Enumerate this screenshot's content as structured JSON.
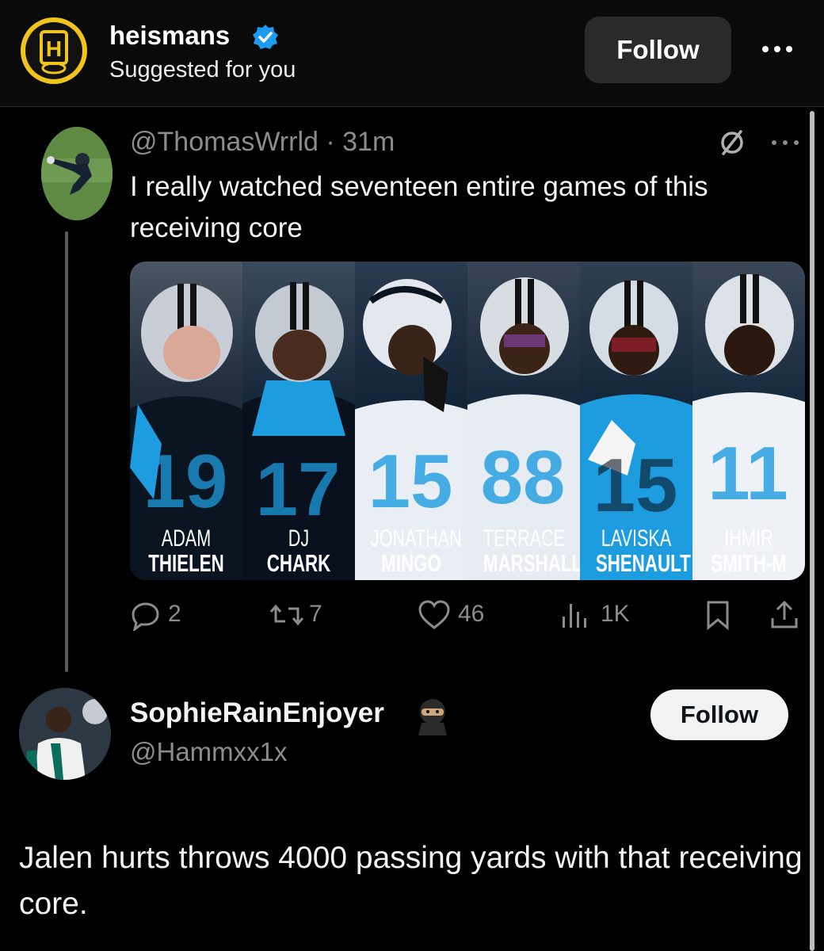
{
  "header": {
    "logo_letter": "H",
    "account_name": "heismans",
    "subtitle": "Suggested for you",
    "follow_label": "Follow"
  },
  "tweet": {
    "handle_line": "@ThomasWrrld · 31m",
    "text": "I really watched seventeen entire games of this receiving core",
    "players": [
      {
        "first": "ADAM",
        "last": "THIELEN",
        "number": "19"
      },
      {
        "first": "DJ",
        "last": "CHARK",
        "number": "17"
      },
      {
        "first": "JONATHAN",
        "last": "MINGO",
        "number": "15"
      },
      {
        "first": "TERRACE",
        "last": "MARSHALL",
        "number": "88"
      },
      {
        "first": "LAVISKA",
        "last": "SHENAULT",
        "number": "15"
      },
      {
        "first": "IHMIR",
        "last": "SMITH-M",
        "number": "11"
      }
    ],
    "actions": {
      "replies": "2",
      "retweets": "7",
      "likes": "46",
      "views": "1K"
    }
  },
  "reply": {
    "name": "SophieRainEnjoyer",
    "handle": "@Hammxx1x",
    "follow_label": "Follow",
    "text": "Jalen hurts throws 4000 passing yards with that receiving core."
  },
  "colors": {
    "accent_gold": "#f0c419",
    "verified_blue": "#1d9bf0",
    "panthers_blue": "#1e9ce0"
  }
}
